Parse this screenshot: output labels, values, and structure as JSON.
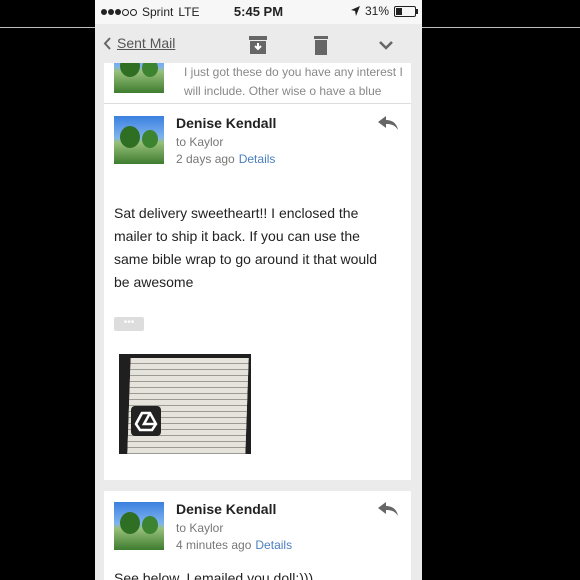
{
  "status_bar": {
    "carrier": "Sprint",
    "network": "LTE",
    "time": "5:45 PM",
    "battery_percent": "31%",
    "battery_level": 0.31
  },
  "toolbar": {
    "back_label": "Sent Mail",
    "icons": [
      "chevron-left-icon",
      "archive-icon",
      "trash-icon",
      "chevron-down-icon"
    ]
  },
  "previous_message": {
    "snippet_line1": "I just got these do you have any interest I",
    "snippet_line2": "will include. Other wise o have a blue"
  },
  "messages": [
    {
      "sender": "Denise Kendall",
      "to": "to Kaylor",
      "time": "2 days ago",
      "details": "Details",
      "body": [
        "Sat delivery sweetheart!! I enclosed the",
        "mailer to ship it back. If you can use the",
        "same bible wrap to go around it that would",
        "be awesome"
      ],
      "more": "•••"
    },
    {
      "sender": "Denise Kendall",
      "to": "to Kaylor",
      "time": "4 minutes ago",
      "details": "Details",
      "body_partial": "See below. I emailed you doll:)))"
    }
  ]
}
